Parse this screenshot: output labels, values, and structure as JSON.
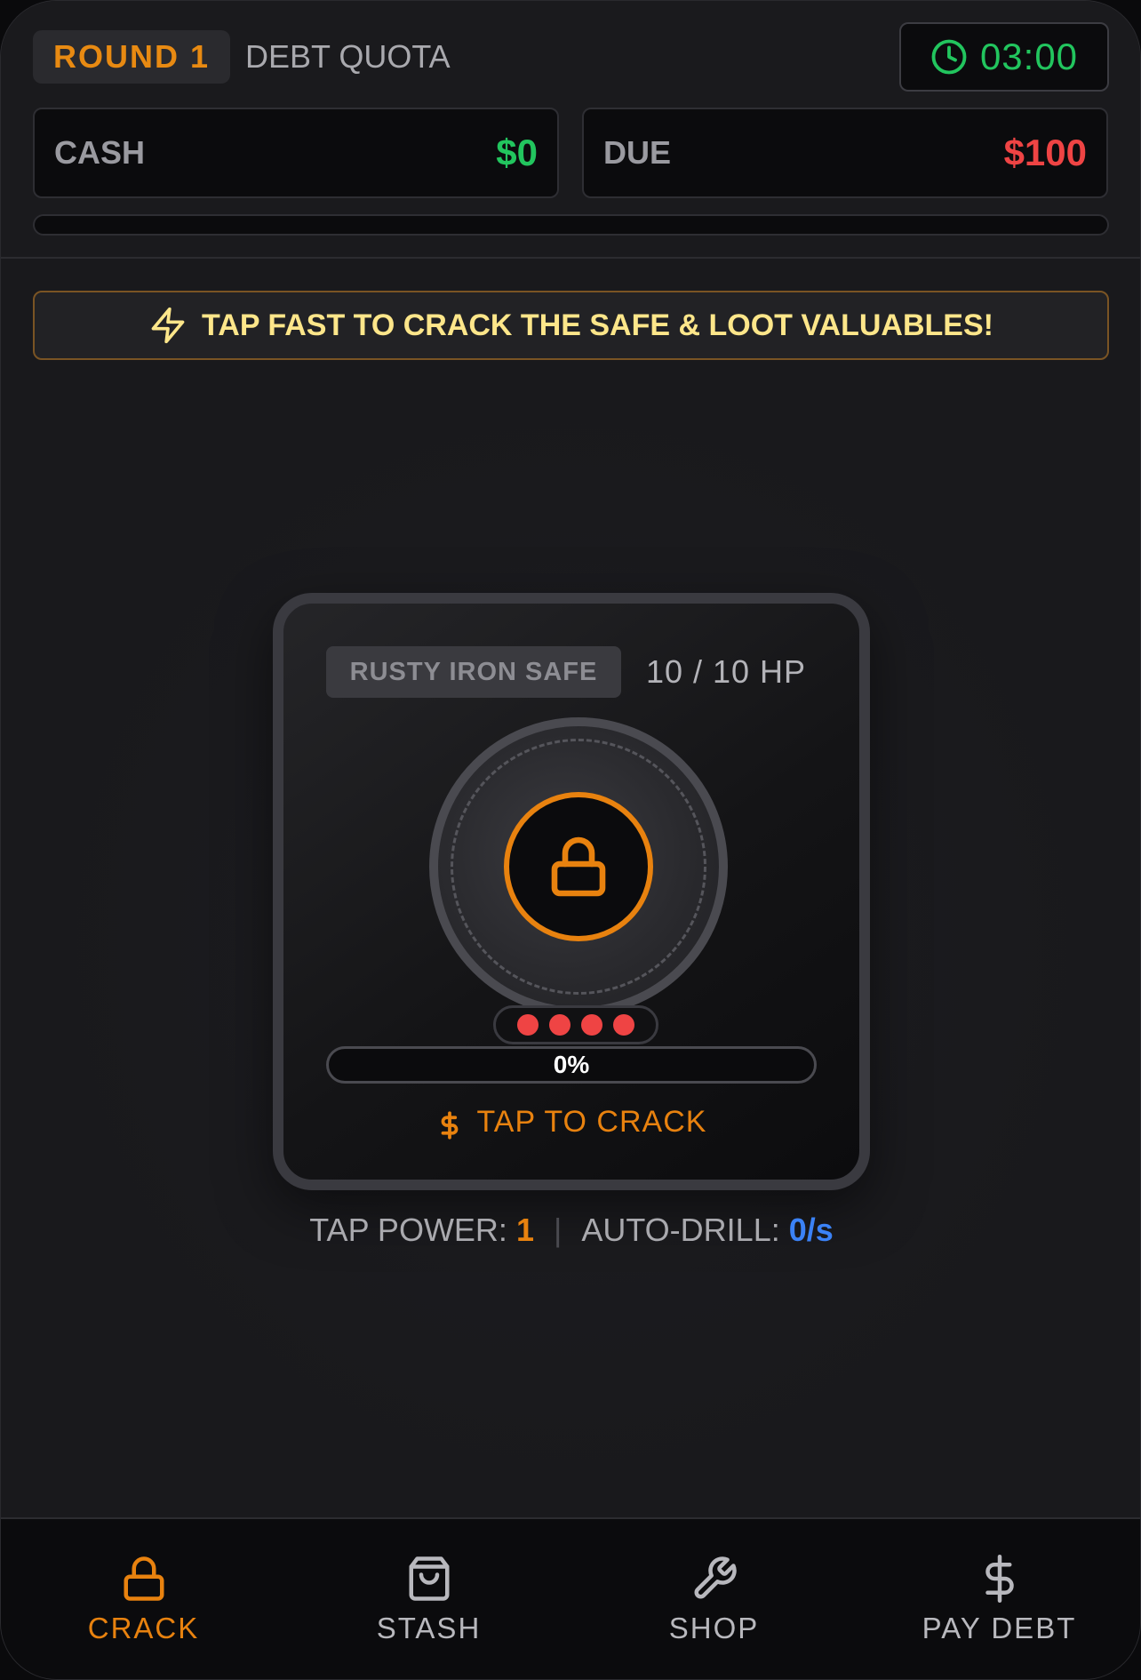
{
  "header": {
    "round_label": "ROUND 1",
    "subtitle": "DEBT QUOTA",
    "timer": "03:00",
    "timer_icon": "clock-icon",
    "cash_label": "CASH",
    "cash_value": "$0",
    "due_label": "DUE",
    "due_value": "$100",
    "quota_progress": 0
  },
  "banner": {
    "icon": "lightning-icon",
    "text": "TAP FAST TO CRACK THE SAFE & LOOT VALUABLES!"
  },
  "safe": {
    "name": "RUSTY IRON SAFE",
    "hp": "10 / 10 HP",
    "lock_icon": "lock-icon",
    "pins_remaining": 4,
    "progress_percent": 0,
    "progress_label": "0%",
    "tap_hint": "TAP TO CRACK",
    "tap_hint_icon": "dollar-icon"
  },
  "stats": {
    "tap_power_label": "TAP POWER: ",
    "tap_power_value": "1",
    "separator": "|",
    "auto_drill_label": "AUTO-DRILL: ",
    "auto_drill_value": "0/s"
  },
  "nav": {
    "items": [
      {
        "label": "CRACK",
        "icon": "lock-icon",
        "active": true
      },
      {
        "label": "STASH",
        "icon": "bag-icon",
        "active": false
      },
      {
        "label": "SHOP",
        "icon": "wrench-icon",
        "active": false
      },
      {
        "label": "PAY DEBT",
        "icon": "dollar-icon",
        "active": false
      }
    ]
  },
  "colors": {
    "accent": "#e8820f",
    "cash": "#22c55e",
    "due": "#ef4444",
    "drill": "#3b82f6",
    "banner_text": "#fde68a"
  }
}
